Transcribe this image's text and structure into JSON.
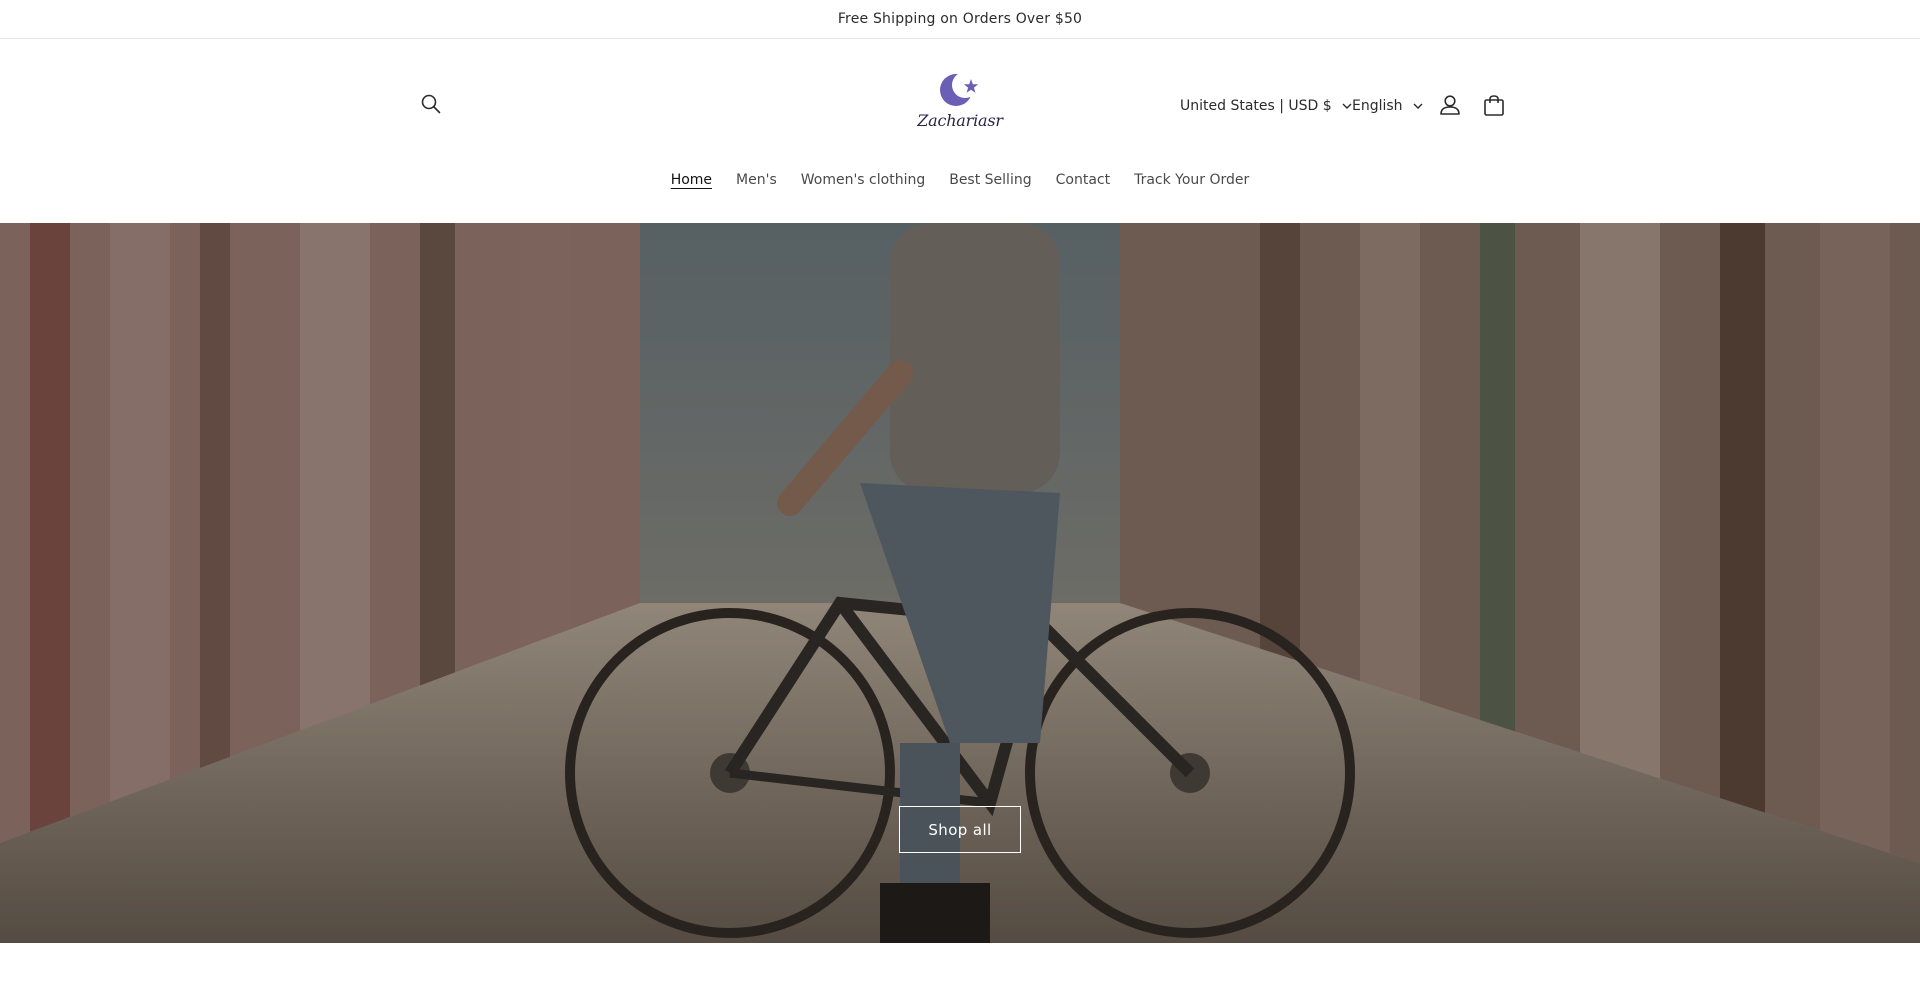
{
  "announcement": {
    "text": "Free Shipping on Orders Over $50"
  },
  "header": {
    "logo_text": "Zachariasr",
    "icons": {
      "search": "search-icon",
      "account": "account-icon",
      "cart": "cart-icon",
      "logo": "crescent-star-icon"
    },
    "country_selector": "United States | USD $",
    "language_selector": "English"
  },
  "nav": {
    "items": [
      {
        "label": "Home",
        "active": true
      },
      {
        "label": "Men's",
        "active": false
      },
      {
        "label": "Women's clothing",
        "active": false
      },
      {
        "label": "Best Selling",
        "active": false
      },
      {
        "label": "Contact",
        "active": false
      },
      {
        "label": "Track Your Order",
        "active": false
      }
    ]
  },
  "hero": {
    "button_label": "Shop all",
    "image_subject": "man-on-bicycle-in-graffiti-alley"
  },
  "colors": {
    "brand": "#6b5fb5",
    "text": "#121212",
    "overlay": "#000000"
  }
}
